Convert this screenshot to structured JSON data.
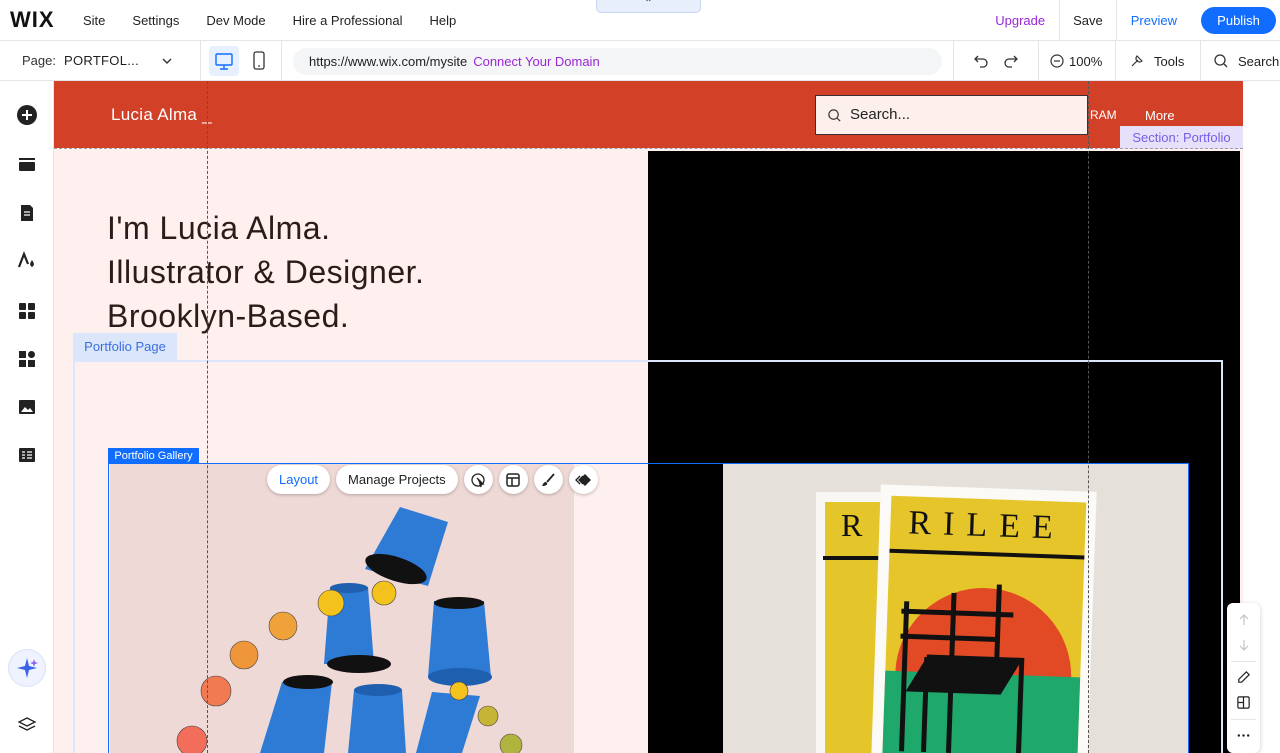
{
  "topbar": {
    "logo": "WIX",
    "menu": [
      "Site",
      "Settings",
      "Dev Mode",
      "Hire a Professional",
      "Help"
    ],
    "upgrade": "Upgrade",
    "save": "Save",
    "preview": "Preview",
    "publish": "Publish",
    "collapse_glyph": "⌃"
  },
  "pagebar": {
    "label": "Page:",
    "page_name": "PORTFOL...",
    "url": "https://www.wix.com/mysite",
    "connect_domain": "Connect Your Domain",
    "zoom": "100%",
    "tools": "Tools",
    "search": "Search"
  },
  "site": {
    "name": "Lucia Alma _",
    "search_placeholder": "Search...",
    "nav_partial": "RAM",
    "nav_more": "More",
    "section_tag": "Section: Portfolio",
    "hero_lines": [
      "I'm Lucia Alma.",
      "Illustrator & Designer.",
      "Brooklyn-Based."
    ],
    "page_tag": "Portfolio Page",
    "gallery_tag": "Portfolio Gallery",
    "magazine_letters": "RILEE",
    "magazine_back_letter": "R"
  },
  "gallery_toolbar": {
    "layout": "Layout",
    "manage": "Manage Projects"
  },
  "colors": {
    "accent": "#116dff",
    "upgrade": "#9a27d5",
    "header_red": "#d24027",
    "hero_bg": "#fdf0ee",
    "section_tag": "#e6e0fb"
  },
  "icons": {
    "left": [
      "add-icon",
      "sections-icon",
      "pages-icon",
      "design-icon",
      "apps-icon",
      "business-apps-icon",
      "media-icon",
      "cms-icon",
      "ai-assistant-icon",
      "layers-icon"
    ]
  }
}
